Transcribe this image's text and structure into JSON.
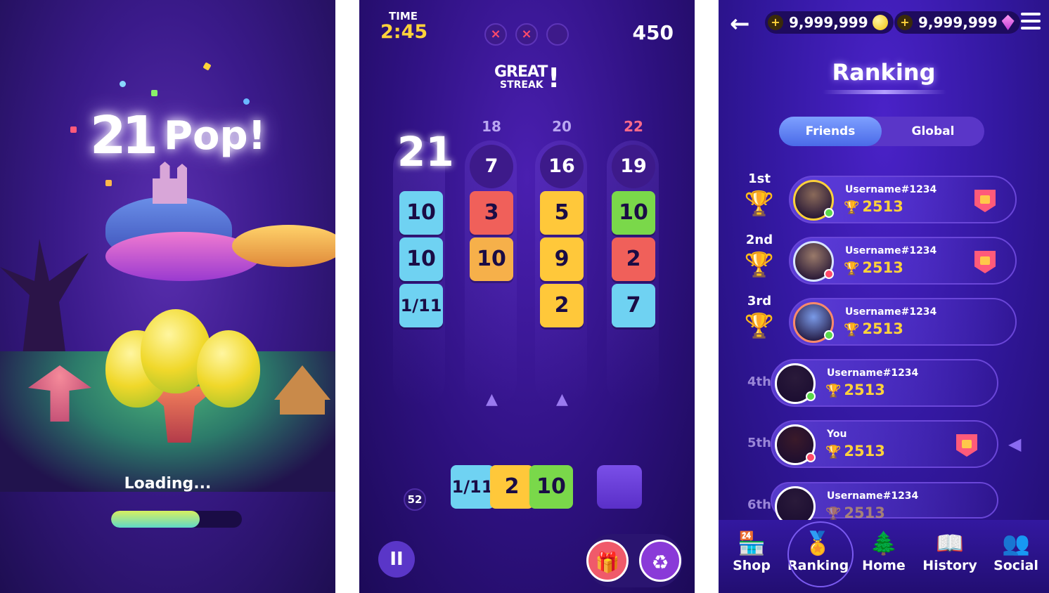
{
  "loading": {
    "logo_num": "21",
    "logo_word": "Pop!",
    "loading_text": "Loading...",
    "progress": 0.68,
    "progress_color": "#d8f060"
  },
  "game": {
    "time_label": "TIME",
    "time_value": "2:45",
    "strikes": [
      "×",
      "×",
      ""
    ],
    "score": "450",
    "streak_great": "GREAT",
    "streak_word": "STREAK",
    "streak_bang": "!",
    "first_col_value": "21",
    "columns": [
      {
        "target": "",
        "sum": "",
        "cards": [
          {
            "label": "10",
            "color": "#6fd2f2"
          },
          {
            "label": "10",
            "color": "#6fd2f2"
          },
          {
            "label": "1/11",
            "color": "#6fd2f2"
          }
        ]
      },
      {
        "target": "18",
        "sum": "7",
        "cards": [
          {
            "label": "3",
            "color": "#f0605a"
          },
          {
            "label": "10",
            "color": "#f6b04a"
          }
        ]
      },
      {
        "target": "20",
        "sum": "16",
        "cards": [
          {
            "label": "5",
            "color": "#ffc83a"
          },
          {
            "label": "9",
            "color": "#ffc83a"
          },
          {
            "label": "2",
            "color": "#ffc83a"
          }
        ]
      },
      {
        "target": "22",
        "sum": "19",
        "cards": [
          {
            "label": "10",
            "color": "#7ad84a"
          },
          {
            "label": "2",
            "color": "#f0605a"
          },
          {
            "label": "7",
            "color": "#6fd2f2"
          }
        ]
      }
    ],
    "deck_count": "52",
    "hand": [
      {
        "label": "1/11",
        "color": "#6fd2f2"
      },
      {
        "label": "2",
        "color": "#ffc83a"
      },
      {
        "label": "10",
        "color": "#7ad84a"
      }
    ],
    "pause_label": "II"
  },
  "ranking": {
    "back_icon": "←",
    "coins": "9,999,999",
    "gems": "9,999,999",
    "title": "Ranking",
    "tabs": [
      "Friends",
      "Global"
    ],
    "active_tab": "Friends",
    "rows": [
      {
        "rank": "1st",
        "name": "Username#1234",
        "score": "2513",
        "trophy": "🏆",
        "trophy_color": "#ffd23a",
        "dot": "#5ad84a",
        "avatar_color": "#8a6a5a",
        "badge": true
      },
      {
        "rank": "2nd",
        "name": "Username#1234",
        "score": "2513",
        "trophy": "🏆",
        "trophy_color": "#d8e4ff",
        "dot": "#ff4a6a",
        "avatar_color": "#9a7a6a",
        "badge": true
      },
      {
        "rank": "3rd",
        "name": "Username#1234",
        "score": "2513",
        "trophy": "🏆",
        "trophy_color": "#ff8a6a",
        "dot": "#5ad84a",
        "avatar_color": "#7a9ae8",
        "badge": false
      },
      {
        "rank": "4th",
        "name": "Username#1234",
        "score": "2513",
        "trophy": "",
        "trophy_color": "",
        "dot": "#5ad84a",
        "avatar_color": "#2a1a3a",
        "badge": false
      },
      {
        "rank": "5th",
        "name": "You",
        "score": "2513",
        "trophy": "",
        "trophy_color": "",
        "dot": "#ff4a6a",
        "avatar_color": "#3a1a2a",
        "badge": true
      },
      {
        "rank": "6th",
        "name": "Username#1234",
        "score": "2513",
        "trophy": "",
        "trophy_color": "",
        "dot": "",
        "avatar_color": "#2a1a3a",
        "badge": false
      }
    ],
    "nav": [
      {
        "label": "Shop",
        "icon": "🏪"
      },
      {
        "label": "Ranking",
        "icon": "🏅"
      },
      {
        "label": "Home",
        "icon": "🌲"
      },
      {
        "label": "History",
        "icon": "📖"
      },
      {
        "label": "Social",
        "icon": "👥"
      }
    ],
    "active_nav": "Ranking"
  }
}
